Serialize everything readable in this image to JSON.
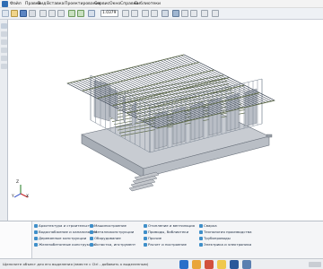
{
  "menu": {
    "items": [
      "Файл",
      "Правка",
      "Вид",
      "Вставка",
      "Проектирование",
      "Сервис",
      "Окно",
      "Справка",
      "Библиотеки"
    ]
  },
  "toolbar": {
    "zoom_value": "1.0379"
  },
  "viewport": {
    "axis_x": "X",
    "axis_y": "Y",
    "axis_z": "Z",
    "colors": {
      "frame": "#7a8592",
      "beam": "#5f6b4a",
      "floor_slab": "#c8ccd2",
      "wall_panel": "#b9bec6",
      "subfloor": "#9aa0a8",
      "stair": "#c3c6cb"
    }
  },
  "library": {
    "tree_items": [
      "",
      "",
      "",
      "",
      "",
      ""
    ],
    "columns": [
      [
        {
          "label": "Архитектура и строительство",
          "icon": "book-icon"
        },
        {
          "label": "Водоснабжение и канализация",
          "icon": "book-icon"
        },
        {
          "label": "Деревянные конструкции",
          "icon": "book-icon"
        },
        {
          "label": "Железобетонные конструкции",
          "icon": "book-icon"
        }
      ],
      [
        {
          "label": "Машиностроение",
          "icon": "book-icon"
        },
        {
          "label": "Металлоконструкции",
          "icon": "book-icon"
        },
        {
          "label": "Оборудование",
          "icon": "book-icon"
        },
        {
          "label": "Оснастка, инструмент",
          "icon": "book-icon"
        }
      ],
      [
        {
          "label": "Отопление и вентиляция",
          "icon": "book-icon"
        },
        {
          "label": "Приводы, библиотеки",
          "icon": "book-icon"
        },
        {
          "label": "Прочие",
          "icon": "book-icon"
        },
        {
          "label": "Расчет и построение",
          "icon": "book-icon"
        }
      ],
      [
        {
          "label": "Сварка",
          "icon": "book-icon"
        },
        {
          "label": "Технология производства",
          "icon": "book-icon"
        },
        {
          "label": "Трубопроводы",
          "icon": "book-icon"
        },
        {
          "label": "Электрика и электроника",
          "icon": "book-icon"
        }
      ]
    ]
  },
  "status": {
    "text": "Щелкните объект для его выделения (вместе с Ctrl - добавить к выделенным)"
  },
  "taskbar": {
    "apps": [
      "windows-start-icon",
      "browser-icon",
      "media-player-icon",
      "file-explorer-icon",
      "word-icon",
      "kompas-icon"
    ]
  }
}
